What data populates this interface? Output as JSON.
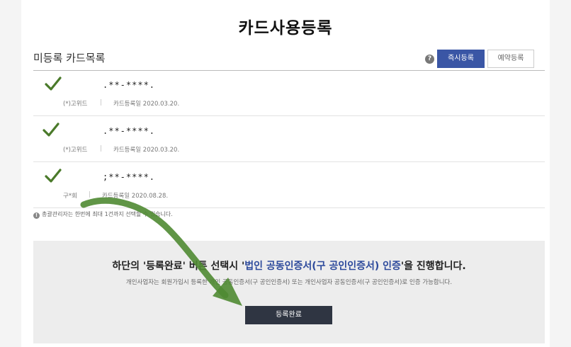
{
  "page": {
    "title": "카드사용등록"
  },
  "section": {
    "title": "미등록 카드목록",
    "help_icon": "?",
    "btn_now": "즉시등록",
    "btn_reserve": "예약등록"
  },
  "cards": [
    {
      "number": ".**-****.",
      "holder": "(*)고위드",
      "separator": "|",
      "reg_date": "카드등록일 2020.03.20."
    },
    {
      "number": ".**-****.",
      "holder": "(*)고위드",
      "separator": "|",
      "reg_date": "카드등록일 2020.03.20."
    },
    {
      "number": ";**-****.",
      "holder": "구*회",
      "separator": "|",
      "reg_date": "카드등록일 2020.08.28."
    }
  ],
  "notice": {
    "icon": "!",
    "text": "총괄관리자는 한번에 최대 1건까지 선택할 수 있습니다."
  },
  "panel": {
    "main_prefix": "하단의 '등록완료' 버튼 선택시 '",
    "main_highlight": "법인 공동인증서(구 공인인증서) 인증",
    "main_suffix": "'을 진행합니다.",
    "sub": "개인사업자는 회원가입시 등록한 개인 공동인증서(구 공인인증서) 또는 개인사업자 공동인증서(구 공인인증서)로 인증 가능합니다.",
    "button": "등록완료"
  },
  "colors": {
    "accent": "#3a56a5",
    "check_green": "#4a7a2a",
    "arrow_green": "#4f8a32",
    "dark_button": "#2f3542"
  },
  "icons": {
    "check": "check-icon",
    "help": "help-icon",
    "notice": "info-icon",
    "arrow": "arrow-annotation"
  }
}
